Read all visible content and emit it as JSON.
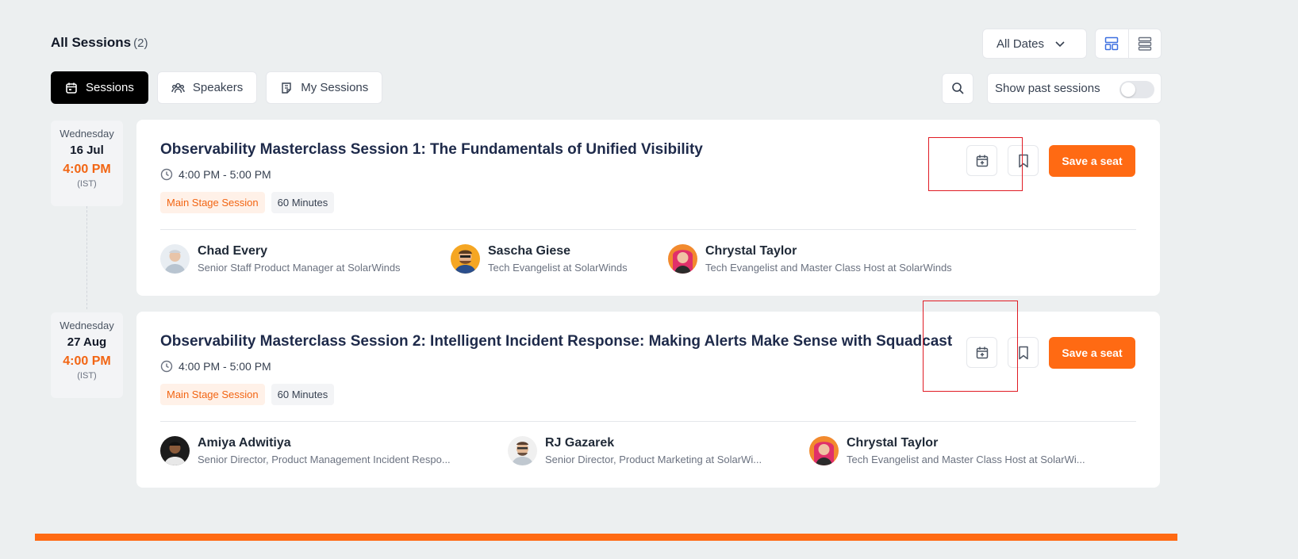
{
  "header": {
    "title": "All Sessions",
    "count": "(2)",
    "dates_filter": "All Dates"
  },
  "tabs": [
    {
      "label": "Sessions",
      "icon": "calendar-icon",
      "active": true
    },
    {
      "label": "Speakers",
      "icon": "speakers-icon",
      "active": false
    },
    {
      "label": "My Sessions",
      "icon": "notes-icon",
      "active": false
    }
  ],
  "filters": {
    "show_past_label": "Show past sessions",
    "show_past_on": false
  },
  "colors": {
    "accent": "#ff6a13",
    "accent_text": "#f26513",
    "title": "#1e2a4a",
    "highlight": "#e01b24"
  },
  "sessions": [
    {
      "dow": "Wednesday",
      "day": "16 Jul",
      "time": "4:00 PM",
      "tz": "(IST)",
      "title": "Observability Masterclass Session 1: The Fundamentals of Unified Visibility",
      "time_range": "4:00 PM - 5:00 PM",
      "tag_stage": "Main Stage Session",
      "tag_duration": "60 Minutes",
      "cta": "Save a seat",
      "speakers": [
        {
          "name": "Chad Every",
          "role": "Senior Staff Product Manager at SolarWinds"
        },
        {
          "name": "Sascha Giese",
          "role": "Tech Evangelist at SolarWinds"
        },
        {
          "name": "Chrystal Taylor",
          "role": "Tech Evangelist and Master Class Host at SolarWinds"
        }
      ]
    },
    {
      "dow": "Wednesday",
      "day": "27 Aug",
      "time": "4:00 PM",
      "tz": "(IST)",
      "title": "Observability Masterclass Session 2: Intelligent Incident Response: Making Alerts Make Sense with Squadcast",
      "time_range": "4:00 PM - 5:00 PM",
      "tag_stage": "Main Stage Session",
      "tag_duration": "60 Minutes",
      "cta": "Save a seat",
      "speakers": [
        {
          "name": "Amiya Adwitiya",
          "role": "Senior Director, Product Management Incident Respo..."
        },
        {
          "name": "RJ Gazarek",
          "role": "Senior Director, Product Marketing at SolarWi..."
        },
        {
          "name": "Chrystal Taylor",
          "role": "Tech Evangelist and Master Class Host at SolarWi..."
        }
      ]
    }
  ]
}
